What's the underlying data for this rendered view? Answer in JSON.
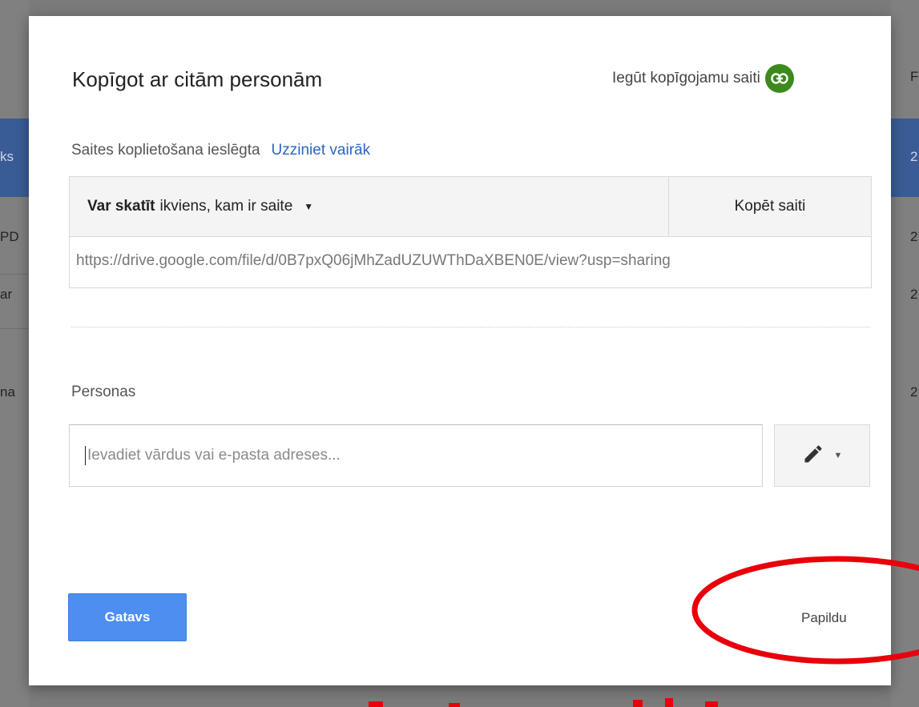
{
  "background": {
    "left_fragments": [
      "ks",
      "PD",
      "ar",
      "na"
    ],
    "right_fragments": [
      "F",
      "2",
      "2",
      "2",
      "2"
    ]
  },
  "dialog": {
    "title": "Kopīgot ar citām personām",
    "get_link_label": "Iegūt kopīgojamu saiti",
    "get_link_icon": "link-icon",
    "link_status": "Saites koplietošana ieslēgta",
    "learn_more": "Uzziniet vairāk",
    "permission_bold": "Var skatīt",
    "permission_rest": "ikviens, kam ir saite",
    "copy_link": "Kopēt saiti",
    "share_url": "https://drive.google.com/file/d/0B7pxQ06jMhZadUZUWThDaXBEN0E/view?usp=sharing",
    "people_label": "Personas",
    "people_placeholder": "Ievadiet vārdus vai e-pasta adreses...",
    "done_button": "Gatavs",
    "more_link": "Papildu"
  },
  "colors": {
    "accent_blue": "#4d8ff0",
    "link_green": "#3c8a1d",
    "annotation_red": "#e8000b"
  }
}
